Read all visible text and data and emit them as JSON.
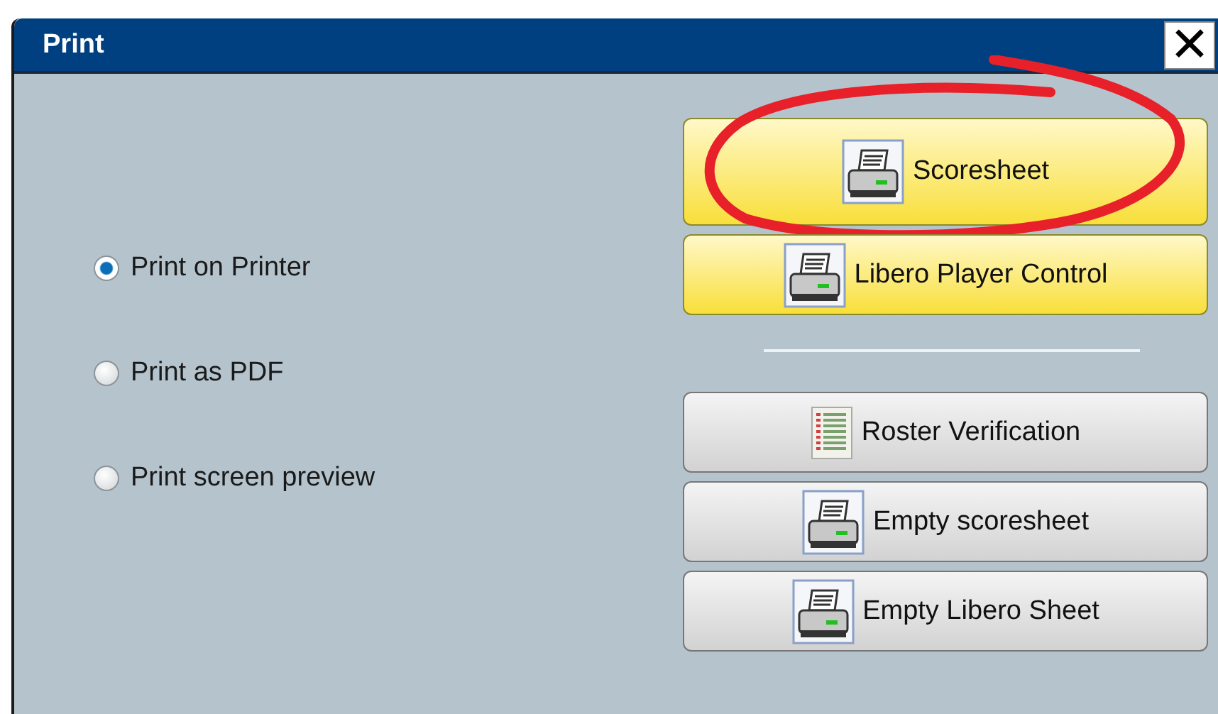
{
  "window": {
    "title": "Print",
    "close_label": "✕"
  },
  "output_options": [
    {
      "label": "Print on Printer",
      "selected": true
    },
    {
      "label": "Print as PDF",
      "selected": false
    },
    {
      "label": "Print screen preview",
      "selected": false
    }
  ],
  "primary_buttons": [
    {
      "label": "Scoresheet",
      "kind": "printer",
      "highlighted": true,
      "circled": true
    },
    {
      "label": "Libero Player Control",
      "kind": "printer",
      "highlighted": true,
      "circled": false
    }
  ],
  "secondary_buttons": [
    {
      "label": "Roster Verification",
      "kind": "list",
      "highlighted": false,
      "circled": false
    },
    {
      "label": "Empty scoresheet",
      "kind": "printer",
      "highlighted": false,
      "circled": false
    },
    {
      "label": "Empty Libero Sheet",
      "kind": "printer",
      "highlighted": false,
      "circled": false
    }
  ]
}
